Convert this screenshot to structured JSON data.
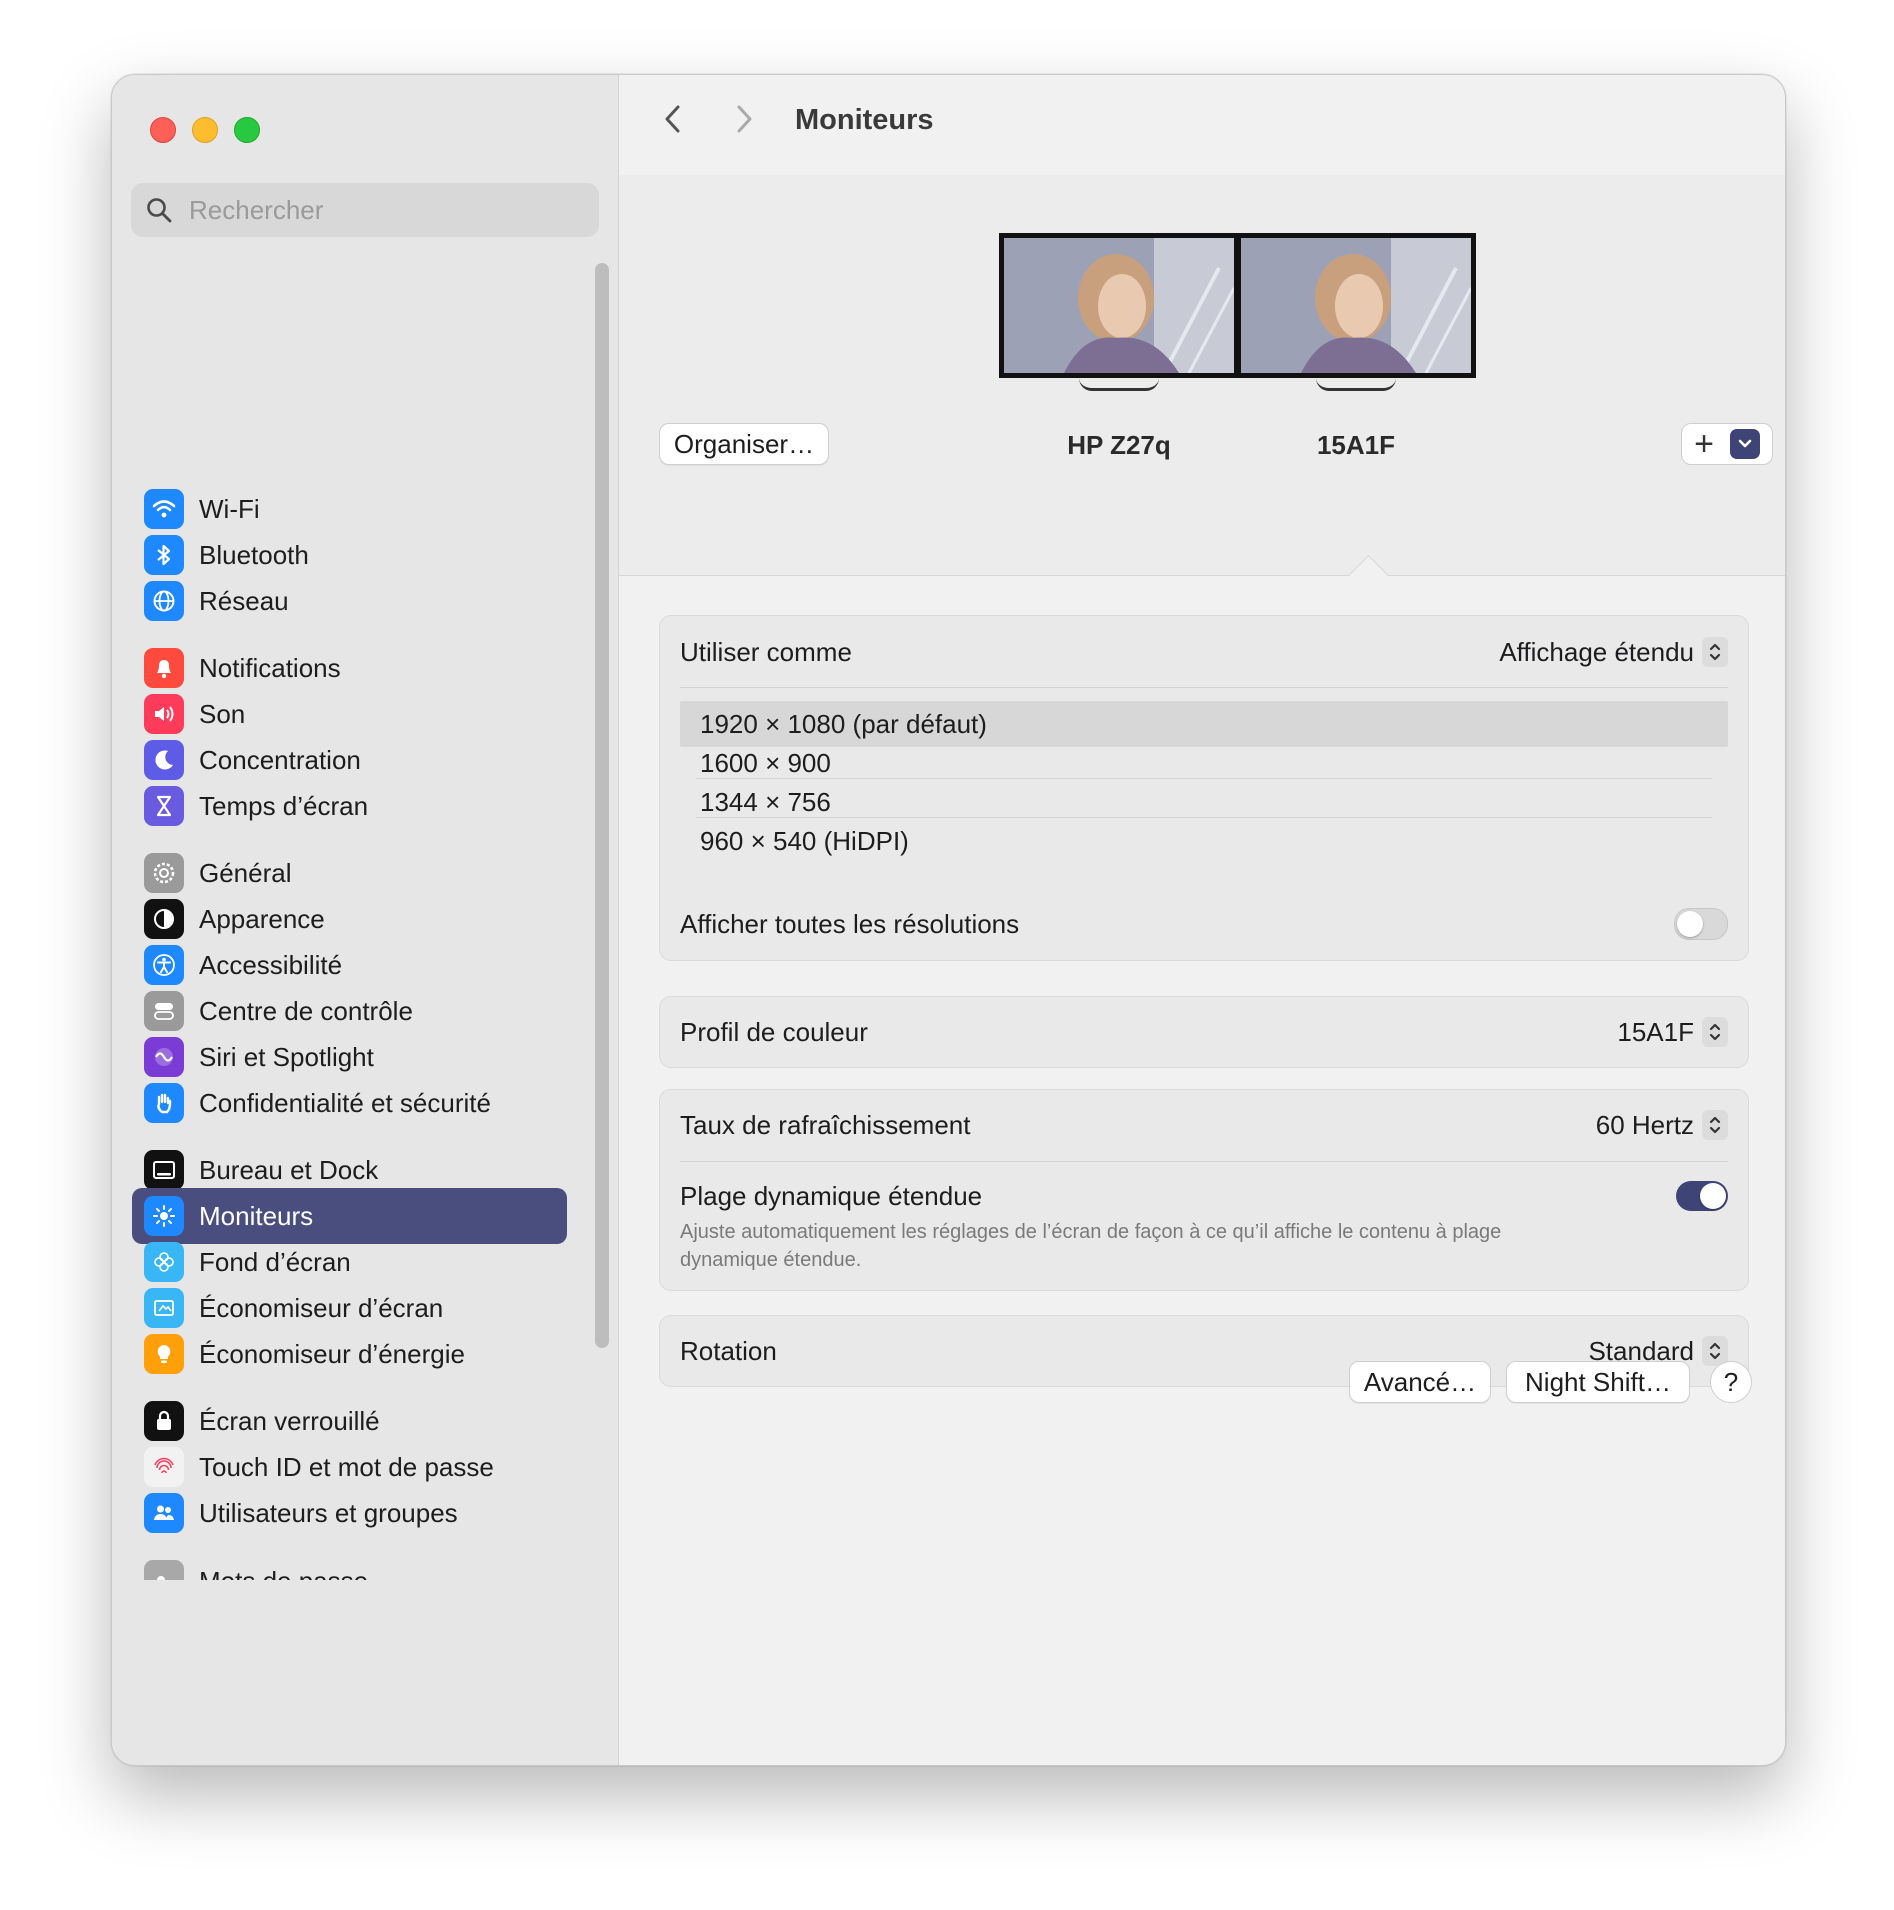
{
  "window": {
    "title": "Moniteurs"
  },
  "search": {
    "placeholder": "Rechercher"
  },
  "sidebar": {
    "items": [
      {
        "label": "Wi-Fi",
        "icon": "wifi-icon",
        "color": "#1e88ff"
      },
      {
        "label": "Bluetooth",
        "icon": "bluetooth-icon",
        "color": "#1e88ff"
      },
      {
        "label": "Réseau",
        "icon": "globe-icon",
        "color": "#1e88ff"
      },
      {
        "label": "Notifications",
        "icon": "bell-icon",
        "color": "#ff4a3d"
      },
      {
        "label": "Son",
        "icon": "speaker-icon",
        "color": "#ff3b5c"
      },
      {
        "label": "Concentration",
        "icon": "moon-icon",
        "color": "#5e5ce6"
      },
      {
        "label": "Temps d’écran",
        "icon": "hourglass-icon",
        "color": "#6a5ae0"
      },
      {
        "label": "Général",
        "icon": "gear-icon",
        "color": "#9a9a9a"
      },
      {
        "label": "Apparence",
        "icon": "appearance-icon",
        "color": "#111111"
      },
      {
        "label": "Accessibilité",
        "icon": "accessibility-icon",
        "color": "#1e88ff"
      },
      {
        "label": "Centre de contrôle",
        "icon": "control-center-icon",
        "color": "#9a9a9a"
      },
      {
        "label": "Siri et Spotlight",
        "icon": "siri-icon",
        "color": "#7a3cd4"
      },
      {
        "label": "Confidentialité et sécurité",
        "icon": "hand-icon",
        "color": "#1e88ff"
      },
      {
        "label": "Bureau et Dock",
        "icon": "dock-icon",
        "color": "#111111"
      },
      {
        "label": "Moniteurs",
        "icon": "brightness-icon",
        "color": "#1e88ff",
        "selected": true
      },
      {
        "label": "Fond d’écran",
        "icon": "flower-icon",
        "color": "#38b6f5"
      },
      {
        "label": "Économiseur d’écran",
        "icon": "screensaver-icon",
        "color": "#38b6f5"
      },
      {
        "label": "Économiseur d’énergie",
        "icon": "bulb-icon",
        "color": "#ff9f0a"
      },
      {
        "label": "Écran verrouillé",
        "icon": "lock-icon",
        "color": "#111111"
      },
      {
        "label": "Touch ID et mot de passe",
        "icon": "fingerprint-icon",
        "color": "#f2f2f2"
      },
      {
        "label": "Utilisateurs et groupes",
        "icon": "users-icon",
        "color": "#1e88ff"
      },
      {
        "label": "Mots de passe",
        "icon": "key-icon",
        "color": "#a8a8a8"
      }
    ]
  },
  "displays": {
    "arrange_label": "Organiser…",
    "monitors": [
      {
        "name": "HP Z27q"
      },
      {
        "name": "15A1F",
        "selected": true
      }
    ],
    "add_label": "+"
  },
  "settings": {
    "use_as_label": "Utiliser comme",
    "use_as_value": "Affichage étendu",
    "resolutions": [
      "1920 × 1080 (par défaut)",
      "1600 × 900",
      "1344 × 756",
      "960 × 540 (HiDPI)"
    ],
    "selected_resolution_index": 0,
    "show_all_label": "Afficher toutes les résolutions",
    "show_all_on": false,
    "color_profile_label": "Profil de couleur",
    "color_profile_value": "15A1F",
    "refresh_label": "Taux de rafraîchissement",
    "refresh_value": "60 Hertz",
    "hdr_label": "Plage dynamique étendue",
    "hdr_desc": "Ajuste automatiquement les réglages de l’écran de façon à ce qu’il affiche le contenu à plage dynamique étendue.",
    "hdr_on": true,
    "rotation_label": "Rotation",
    "rotation_value": "Standard"
  },
  "footer": {
    "advanced_label": "Avancé…",
    "night_shift_label": "Night Shift…",
    "help_label": "?"
  },
  "colors": {
    "accent": "#3f4477",
    "selection": "#4a4e7e"
  }
}
